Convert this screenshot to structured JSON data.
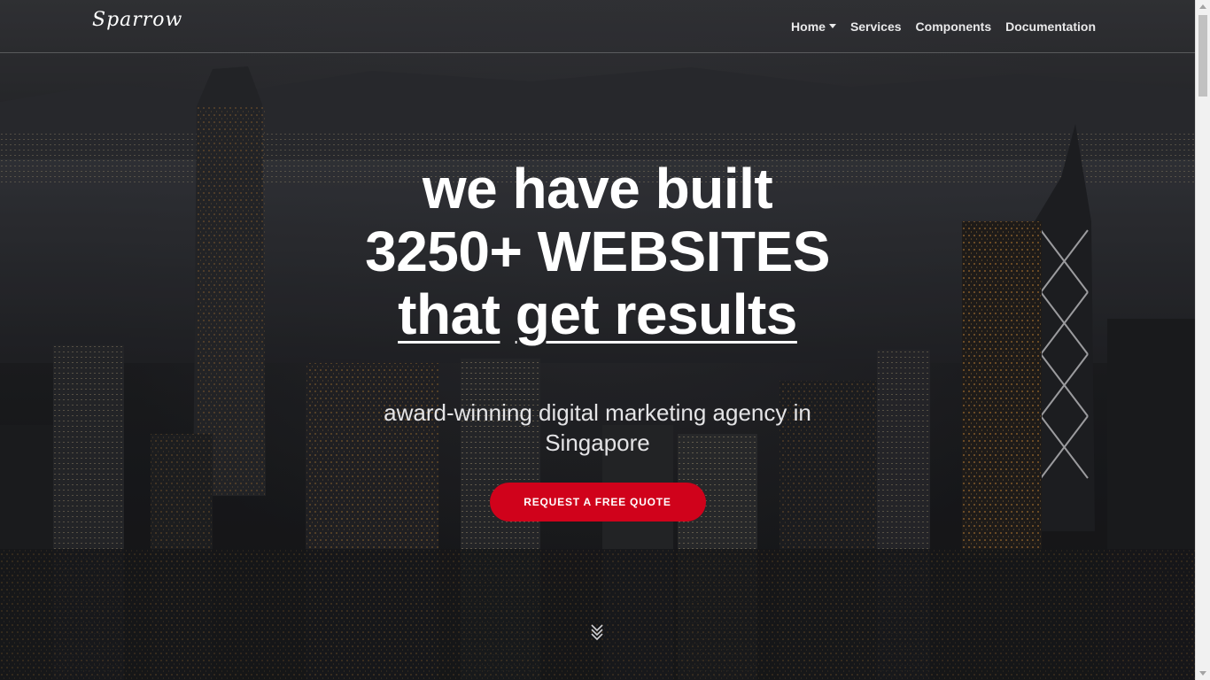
{
  "brand": {
    "name": "Sparrow"
  },
  "nav": {
    "items": [
      {
        "label": "Home",
        "has_dropdown": true
      },
      {
        "label": "Services",
        "has_dropdown": false
      },
      {
        "label": "Components",
        "has_dropdown": false
      },
      {
        "label": "Documentation",
        "has_dropdown": false
      }
    ]
  },
  "hero": {
    "headline_line1": "we have built",
    "headline_line2": "3250+ WEBSITES",
    "headline_line3_word1": "that",
    "headline_line3_word2": "get results",
    "subtitle": "award-winning digital marketing agency in Singapore",
    "cta_label": "REQUEST A FREE QUOTE",
    "scroll_icon": "chevrons-down-icon"
  },
  "colors": {
    "accent": "#d0021b",
    "text": "#ffffff",
    "nav_text": "#e9e9ea"
  }
}
